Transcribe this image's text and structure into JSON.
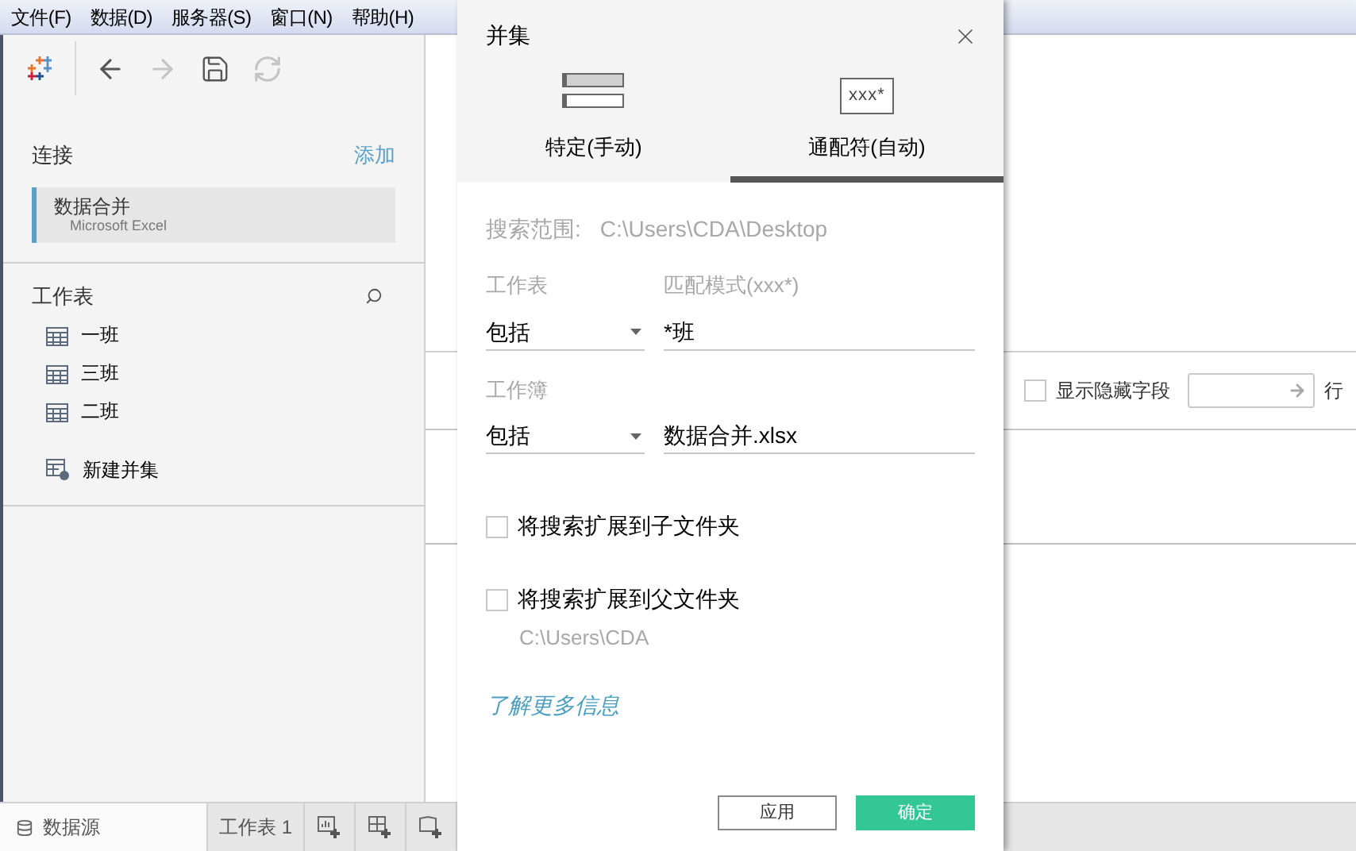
{
  "menu": [
    "文件(F)",
    "数据(D)",
    "服务器(S)",
    "窗口(N)",
    "帮助(H)"
  ],
  "toolbar": [
    {
      "kind": "back",
      "disabled": false
    },
    {
      "kind": "forward",
      "disabled": true
    },
    {
      "kind": "save",
      "disabled": false
    },
    {
      "kind": "refresh",
      "disabled": true
    }
  ],
  "sidebar": {
    "connections_title": "连接",
    "add_link": "添加",
    "connections": [
      {
        "name": "数据合并",
        "type": "Microsoft Excel",
        "selected": true
      }
    ],
    "sheets_title": "工作表",
    "sheets": [
      {
        "name": "一班"
      },
      {
        "name": "三班"
      },
      {
        "name": "二班"
      }
    ],
    "new_union": "新建并集"
  },
  "main": {
    "show_hidden": {
      "label": "显示隐藏字段",
      "checked": false
    },
    "rows_label": "行"
  },
  "bottom_tabs": [
    {
      "label": "数据源",
      "selected": true,
      "kind": "datasource"
    },
    {
      "label": "工作表 1",
      "selected": false,
      "kind": "sheet"
    }
  ],
  "dialog": {
    "title": "并集",
    "tabs": [
      {
        "label": "特定(手动)",
        "selected": false,
        "kind": "manual"
      },
      {
        "label": "通配符(自动)",
        "selected": true,
        "kind": "wildcard",
        "icon_text": "xxx*"
      }
    ],
    "search_scope": {
      "label": "搜索范围:",
      "value": "C:\\Users\\CDA\\Desktop"
    },
    "filters": [
      {
        "label": "工作表",
        "pattern_label": "匹配模式(xxx*)",
        "mode": "包括",
        "value": "*班"
      },
      {
        "label": "工作簿",
        "mode": "包括",
        "value": "数据合并.xlsx"
      }
    ],
    "options": [
      {
        "label": "将搜索扩展到子文件夹",
        "checked": false
      },
      {
        "label": "将搜索扩展到父文件夹",
        "checked": false,
        "path": "C:\\Users\\CDA"
      }
    ],
    "learn_more": "了解更多信息",
    "buttons": [
      {
        "label": "应用",
        "kind": "secondary"
      },
      {
        "label": "确定",
        "kind": "primary"
      }
    ]
  }
}
